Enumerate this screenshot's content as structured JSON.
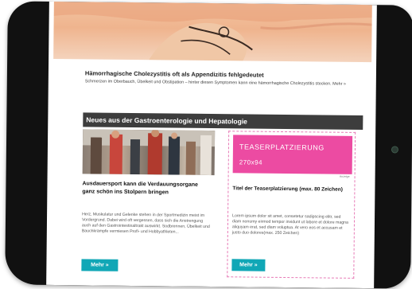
{
  "article": {
    "title": "Hämorrhagische Cholezystitis oft als Appendizitis fehlgedeutet",
    "text": "Schmerzen im Oberbauch, Übelkeit und Obstipation – hinter diesen Symptomen kann eine hämorrhagische Cholezystitis stecken. Mehr »"
  },
  "section": {
    "title": "Neues aus der Gastroenterologie und Hepatologie"
  },
  "news": {
    "title": "Ausdauersport kann die Verdauungsorgane ganz schön ins Stolpern bringen",
    "text": "Herz, Muskulatur und Gelenke stehen in der Sportmedizin meist im Vordergrund. Dabei wird oft vergessen, dass sich die Anstrengung auch auf den Gastrointestinaltrakt auswirkt. Sodbrennen, Übelkeit und Bauchkrämpfe vermiesen Profi- und Hobbyathleten...",
    "button": "Mehr »"
  },
  "teaser": {
    "placeholder_line1": "TEASERPLATZIERUNG",
    "placeholder_line2": "270x94",
    "caption": "Anzeige",
    "title": "Titel der Teaserplatzierung (max. 80 Zeichen)",
    "text": "Lorem ipsum dolor sit amet, consetetur sadipscing elitr, sed diam nonumy eirmod tempor invidunt ut labore et dolore magna aliquyam erat, sed diam voluptua. At vero eos et accusam et justo duo dolores(max. 250 Zeichen)",
    "button": "Mehr »",
    "color": "#ec4ba2"
  },
  "colors": {
    "accent": "#11a7b6",
    "section_bar": "#3d3d3d"
  }
}
